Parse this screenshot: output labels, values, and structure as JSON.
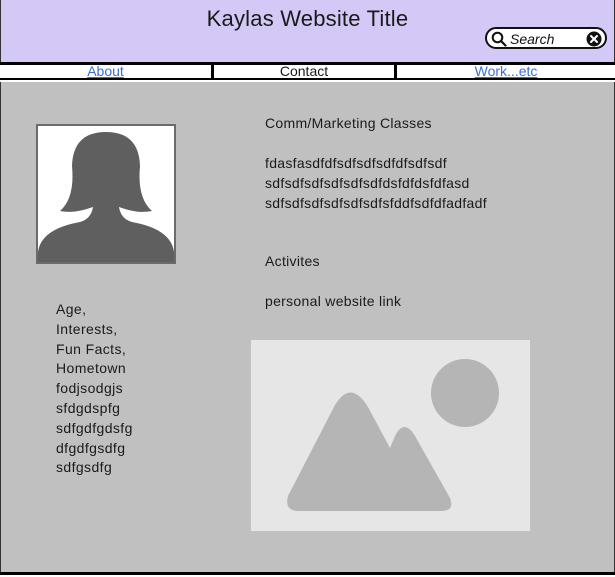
{
  "header": {
    "title": "Kaylas Website Title",
    "bg_color": "#d4c8f7"
  },
  "search": {
    "placeholder": "Search",
    "icon": "search-icon",
    "clear_icon": "close-icon"
  },
  "nav": {
    "items": [
      {
        "label": "About",
        "state": "link"
      },
      {
        "label": "Contact",
        "state": "current"
      },
      {
        "label": "Work...etc",
        "state": "link"
      }
    ],
    "link_color": "#3a6fd8"
  },
  "sidebar": {
    "avatar_icon": "person-silhouette-icon",
    "lines": [
      "Age,",
      "Interests,",
      "Fun Facts,",
      "Hometown",
      "fodjsodgjs",
      "sfdgdspfg",
      "sdfgdfgdsfg",
      "dfgdfgsdfg",
      "sdfgsdfg"
    ]
  },
  "main": {
    "classes_heading": "Comm/Marketing Classes",
    "classes_lines": [
      "fdasfasdfdfsdfsdfsdfdfsdfsdf",
      "sdfsdfsdfsdfsdfsdfdsfdfdsfdfasd",
      "sdfsdfsdfsdfsdfsdfsfddfsdfdfadfadf"
    ],
    "activities_heading": "Activites",
    "website_link": "personal website link",
    "image_icon": "image-placeholder-icon",
    "panel_color": "#c0c0c0"
  }
}
